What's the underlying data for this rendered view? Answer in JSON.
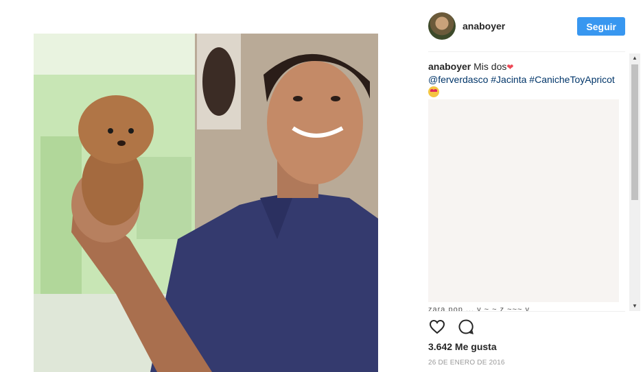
{
  "post": {
    "image_alt": "Photo of a man holding an apricot toy poodle puppy"
  },
  "header": {
    "username": "anaboyer",
    "follow_label": "Seguir"
  },
  "caption": {
    "username": "anaboyer",
    "text": "Mis dos",
    "mention": "@ferverdasco",
    "hashtags": [
      "#Jacinta",
      "#CanicheToyApricot"
    ]
  },
  "comments": {
    "cutoff_text": "zara pop ... y   ~   ~    z    ~~~ v"
  },
  "actions": {
    "like_icon": "heart-icon",
    "comment_icon": "comment-bubble-icon"
  },
  "stats": {
    "likes": "3.642 Me gusta",
    "date": "26 DE ENERO DE 2016"
  },
  "colors": {
    "accent": "#3897f0",
    "link": "#003569",
    "text": "#262626",
    "muted": "#999999"
  }
}
